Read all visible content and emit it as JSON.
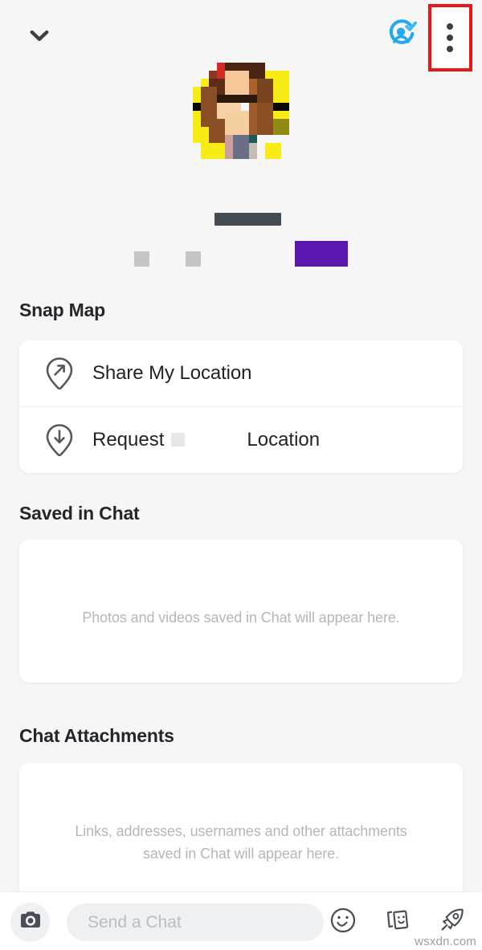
{
  "header": {
    "collapse_icon": "chevron-down-icon",
    "friend_status_icon": "friend-added-verified-icon",
    "more_icon": "three-dot-menu-icon",
    "highlight_color": "#e81717",
    "accent_blue": "#22a8f0"
  },
  "profile": {
    "avatar_icon": "bitmoji-avatar-pixelated",
    "display_name_redacted": true,
    "badge_color": "#5b16b0"
  },
  "sections": {
    "snap_map": {
      "title": "Snap Map",
      "rows": [
        {
          "icon": "location-pin-share-icon",
          "label": "Share My Location"
        },
        {
          "icon": "location-pin-request-icon",
          "label_prefix": "Request",
          "label_suffix": "Location",
          "name_redacted": true
        }
      ]
    },
    "saved_in_chat": {
      "title": "Saved in Chat",
      "empty_text": "Photos and videos saved in Chat will appear here."
    },
    "chat_attachments": {
      "title": "Chat Attachments",
      "empty_text_line1": "Links, addresses, usernames and other attachments",
      "empty_text_line2": "saved in Chat will appear here."
    }
  },
  "chat_bar": {
    "camera_icon": "camera-icon",
    "input_placeholder": "Send a Chat",
    "input_value": "",
    "actions": [
      {
        "icon": "smiley-face-icon"
      },
      {
        "icon": "stickers-cards-icon"
      },
      {
        "icon": "rocket-icon"
      }
    ]
  },
  "watermark": {
    "text": "wsxdn.com"
  }
}
